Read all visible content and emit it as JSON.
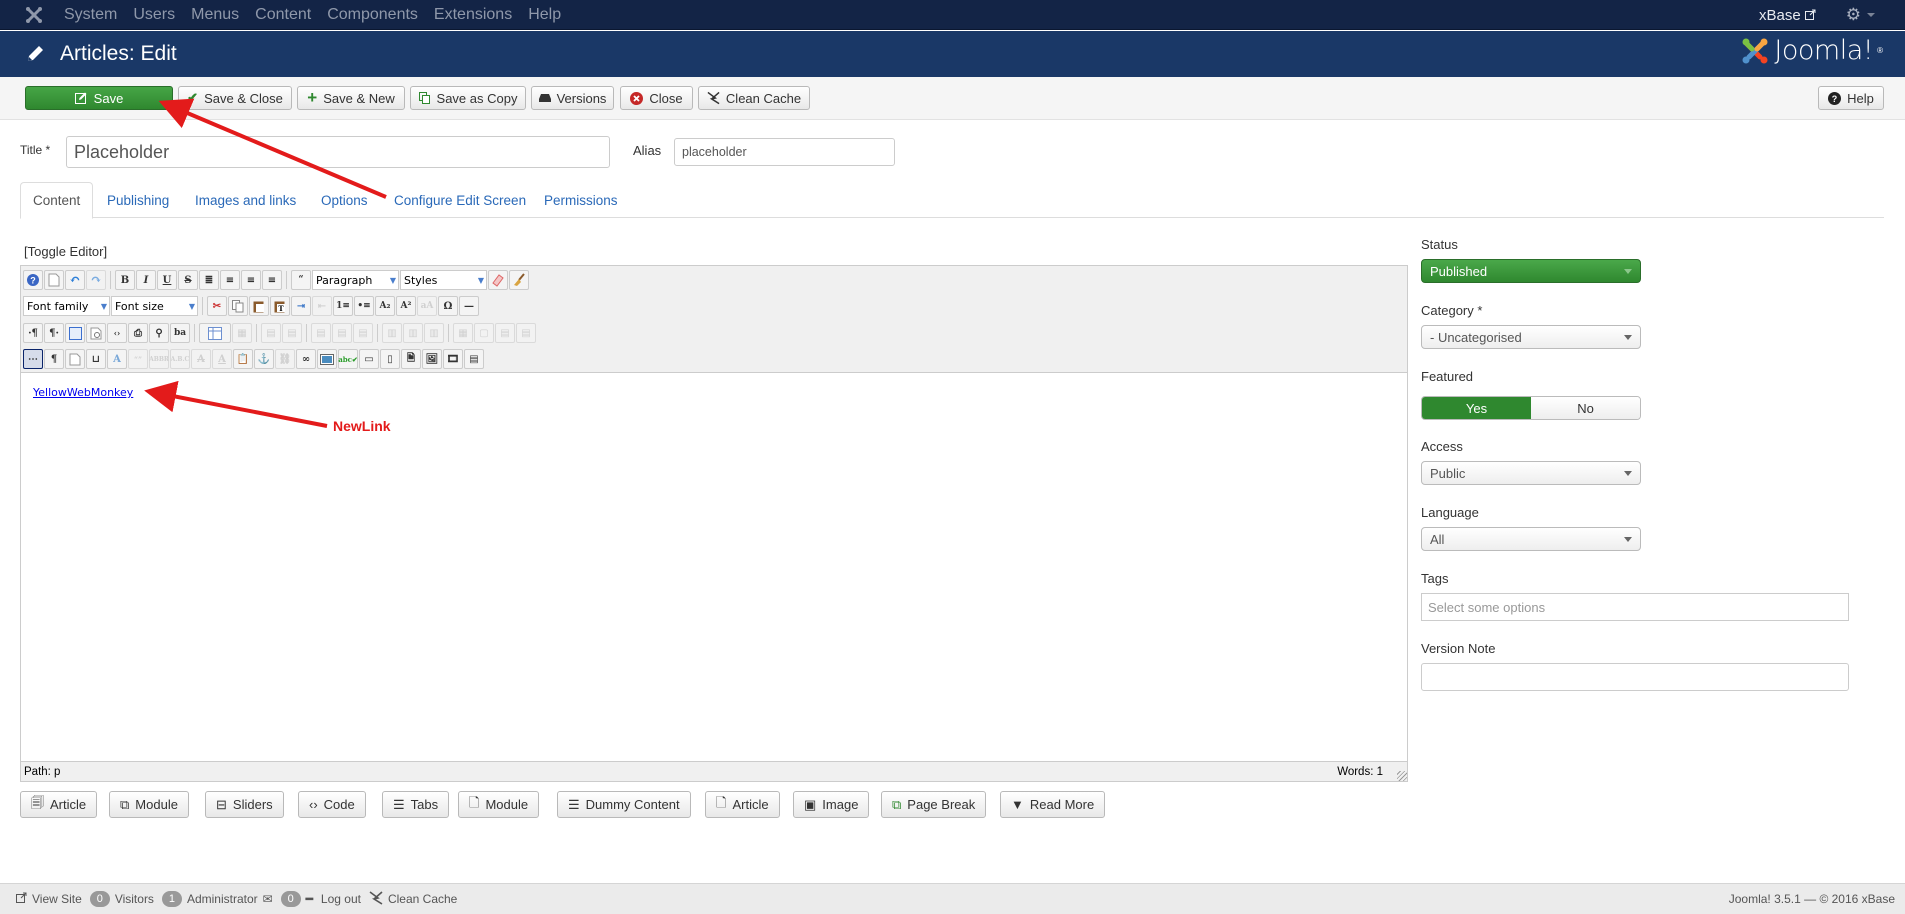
{
  "topnav": {
    "menu": [
      "System",
      "Users",
      "Menus",
      "Content",
      "Components",
      "Extensions",
      "Help"
    ],
    "site_link": "xBase",
    "icons": {
      "logo": "joomla-icon",
      "external": "external-link-icon",
      "settings": "gear-icon"
    }
  },
  "header": {
    "title": "Articles: Edit",
    "brand": "Joomla!",
    "brand_mark": "®"
  },
  "toolbar": {
    "buttons": [
      {
        "label": "Save",
        "icon": "edit-icon"
      },
      {
        "label": "Save & Close",
        "icon": "check-icon"
      },
      {
        "label": "Save & New",
        "icon": "plus-icon"
      },
      {
        "label": "Save as Copy",
        "icon": "copy-icon"
      },
      {
        "label": "Versions",
        "icon": "archive-icon"
      },
      {
        "label": "Close",
        "icon": "cancel-circle-icon"
      },
      {
        "label": "Clean Cache",
        "icon": "flash-icon"
      }
    ],
    "help": {
      "label": "Help",
      "icon": "question-circle-icon"
    }
  },
  "form": {
    "title_label": "Title *",
    "title_value": "Placeholder",
    "alias_label": "Alias",
    "alias_value": "placeholder"
  },
  "tabs": [
    {
      "label": "Content",
      "active": true
    },
    {
      "label": "Publishing",
      "active": false
    },
    {
      "label": "Images and links",
      "active": false
    },
    {
      "label": "Options",
      "active": false
    },
    {
      "label": "Configure Edit Screen",
      "active": false
    },
    {
      "label": "Permissions",
      "active": false
    }
  ],
  "editor": {
    "toggle_label": "[Toggle Editor]",
    "format_select": "Paragraph",
    "styles_select": "Styles",
    "font_family_select": "Font family",
    "font_size_select": "Font size",
    "content_link": "YellowWebMonkey",
    "path": "Path:  p",
    "words": "Words: 1"
  },
  "extension_buttons": [
    {
      "label": "Article",
      "icon": "article-icon"
    },
    {
      "label": "Module",
      "icon": "module-icon"
    },
    {
      "label": "Sliders",
      "icon": "sliders-icon"
    },
    {
      "label": "Code",
      "icon": "code-icon"
    },
    {
      "label": "Tabs",
      "icon": "tabs-icon"
    },
    {
      "label": "Module",
      "icon": "file-add-icon"
    },
    {
      "label": "Dummy Content",
      "icon": "list-icon"
    },
    {
      "label": "Article",
      "icon": "file-add-icon"
    },
    {
      "label": "Image",
      "icon": "picture-icon"
    },
    {
      "label": "Page Break",
      "icon": "copy-icon"
    },
    {
      "label": "Read More",
      "icon": "arrow-down-icon"
    }
  ],
  "sidebar": {
    "status_label": "Status",
    "status_value": "Published",
    "category_label": "Category *",
    "category_value": "- Uncategorised",
    "featured_label": "Featured",
    "featured_yes": "Yes",
    "featured_no": "No",
    "featured_value": "Yes",
    "access_label": "Access",
    "access_value": "Public",
    "language_label": "Language",
    "language_value": "All",
    "tags_label": "Tags",
    "tags_placeholder": "Select some options",
    "version_note_label": "Version Note",
    "version_note_value": ""
  },
  "annotations": {
    "newlink_label": "NewLink",
    "color": "#e31b1b"
  },
  "footer": {
    "view_site": "View Site",
    "visitors_count": "0",
    "visitors_label": "Visitors",
    "admin_count": "1",
    "admin_label": "Administrator",
    "messages_count": "0",
    "logout": "Log out",
    "clean_cache": "Clean Cache",
    "copyright": "Joomla! 3.5.1  —  © 2016 xBase"
  },
  "colors": {
    "nav_bg": "#132446",
    "header_bg": "#1a3867",
    "success": "#2f882f",
    "link": "#2a69b8"
  }
}
